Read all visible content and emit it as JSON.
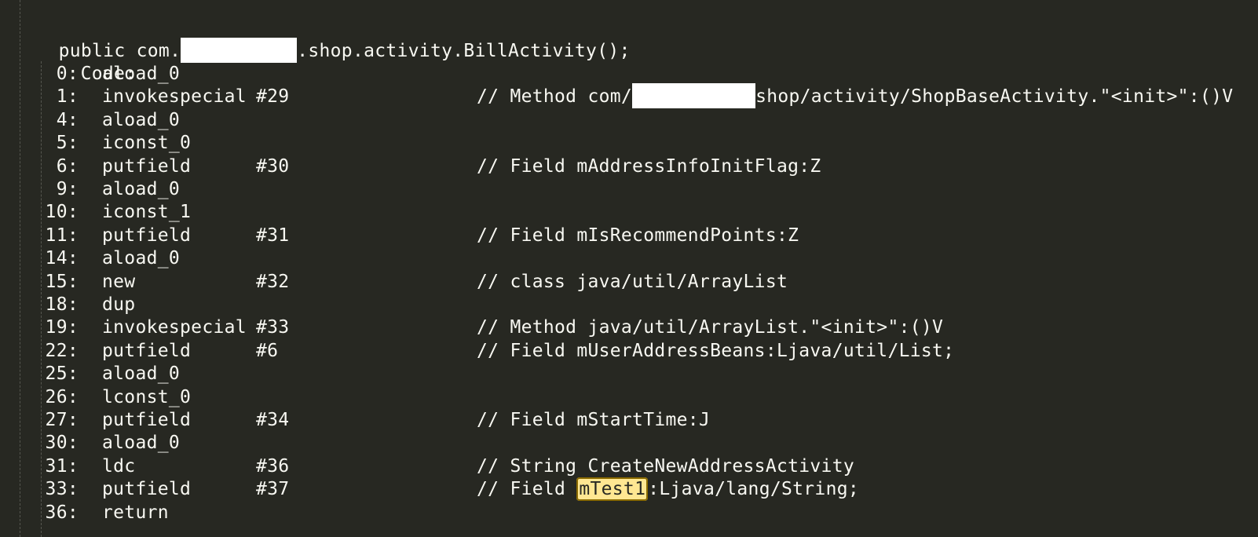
{
  "header": {
    "prefix": "public com.",
    "suffix": ".shop.activity.BillActivity();"
  },
  "code_label": "Code:",
  "instructions": [
    {
      "offset": "0:",
      "op": "aload_0",
      "arg": "",
      "comment": ""
    },
    {
      "offset": "1:",
      "op": "invokespecial",
      "arg": "#29",
      "comment_prefix": "// Method com/",
      "comment_suffix": "shop/activity/ShopBaseActivity.\"<init>\":()V"
    },
    {
      "offset": "4:",
      "op": "aload_0",
      "arg": "",
      "comment": ""
    },
    {
      "offset": "5:",
      "op": "iconst_0",
      "arg": "",
      "comment": ""
    },
    {
      "offset": "6:",
      "op": "putfield",
      "arg": "#30",
      "comment": "// Field mAddressInfoInitFlag:Z"
    },
    {
      "offset": "9:",
      "op": "aload_0",
      "arg": "",
      "comment": ""
    },
    {
      "offset": "10:",
      "op": "iconst_1",
      "arg": "",
      "comment": ""
    },
    {
      "offset": "11:",
      "op": "putfield",
      "arg": "#31",
      "comment": "// Field mIsRecommendPoints:Z"
    },
    {
      "offset": "14:",
      "op": "aload_0",
      "arg": "",
      "comment": ""
    },
    {
      "offset": "15:",
      "op": "new",
      "arg": "#32",
      "comment": "// class java/util/ArrayList"
    },
    {
      "offset": "18:",
      "op": "dup",
      "arg": "",
      "comment": ""
    },
    {
      "offset": "19:",
      "op": "invokespecial",
      "arg": "#33",
      "comment": "// Method java/util/ArrayList.\"<init>\":()V"
    },
    {
      "offset": "22:",
      "op": "putfield",
      "arg": "#6",
      "comment": "// Field mUserAddressBeans:Ljava/util/List;"
    },
    {
      "offset": "25:",
      "op": "aload_0",
      "arg": "",
      "comment": ""
    },
    {
      "offset": "26:",
      "op": "lconst_0",
      "arg": "",
      "comment": ""
    },
    {
      "offset": "27:",
      "op": "putfield",
      "arg": "#34",
      "comment": "// Field mStartTime:J"
    },
    {
      "offset": "30:",
      "op": "aload_0",
      "arg": "",
      "comment": ""
    },
    {
      "offset": "31:",
      "op": "ldc",
      "arg": "#36",
      "comment": "// String CreateNewAddressActivity"
    },
    {
      "offset": "33:",
      "op": "putfield",
      "arg": "#37",
      "comment_prefix": "// Field ",
      "highlight": "mTest1",
      "comment_suffix": ":Ljava/lang/String;"
    },
    {
      "offset": "36:",
      "op": "return",
      "arg": "",
      "comment": ""
    }
  ],
  "colors": {
    "background": "#272822",
    "text": "#f8f8f2",
    "highlight": "#ffe792",
    "redaction": "#ffffff"
  }
}
